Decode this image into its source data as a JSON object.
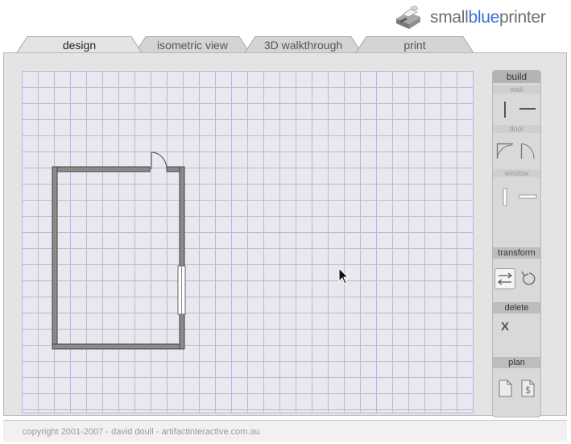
{
  "logo": {
    "text_small": "small",
    "text_blue": "blue",
    "text_printer": "printer",
    "icon": "printer-logo-icon",
    "accent_color": "#3a6ed8"
  },
  "tabs": [
    {
      "label": "design",
      "active": true
    },
    {
      "label": "isometric view",
      "active": false
    },
    {
      "label": "3D walkthrough",
      "active": false
    },
    {
      "label": "print",
      "active": false
    }
  ],
  "toolbar": {
    "build_label": "build",
    "wall_label": "wall",
    "door_label": "door",
    "window_label": "window",
    "transform_label": "transform",
    "delete_label": "delete",
    "delete_symbol": "X",
    "plan_label": "plan",
    "icons": {
      "wall_vertical": "wall-vertical-icon",
      "wall_horizontal": "wall-horizontal-icon",
      "door_left": "door-left-icon",
      "door_right": "door-right-icon",
      "window_vertical": "window-vertical-icon",
      "window_horizontal": "window-horizontal-icon",
      "flip": "flip-arrows-icon",
      "rotate": "rotate-icon",
      "new_plan": "new-plan-icon",
      "save_plan": "save-plan-icon"
    }
  },
  "colors": {
    "grid_line": "#b8b8e6",
    "grid_bg": "#e8e8ee",
    "panel_bg": "#e4e4e4",
    "wall": "#8a8a8a"
  },
  "footer": {
    "copyright": "copyright 2001-2007 - david doull - artifactinteractive.com.au"
  }
}
